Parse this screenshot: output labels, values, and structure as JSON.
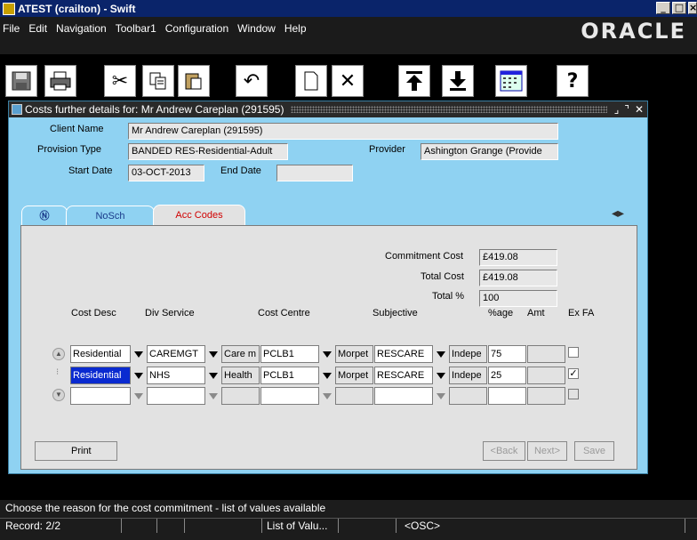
{
  "window": {
    "title": "ATEST (crailton) - Swift"
  },
  "menu": {
    "items": [
      "File",
      "Edit",
      "Navigation",
      "Toolbar1",
      "Configuration",
      "Window",
      "Help"
    ],
    "brand": "ORACLE"
  },
  "toolbar": {
    "icons": [
      "save-icon",
      "print-icon",
      "cut-icon",
      "copy-icon",
      "paste-icon",
      "undo-icon",
      "new-icon",
      "delete-icon",
      "first-record-icon",
      "last-record-icon",
      "calculator-icon",
      "help-icon"
    ],
    "help_label": "?"
  },
  "form": {
    "title": "Costs further details for: Mr Andrew Careplan (291595)",
    "client_name_label": "Client Name",
    "client_name": "Mr Andrew Careplan (291595)",
    "provision_type_label": "Provision Type",
    "provision_type": "BANDED RES-Residential-Adult",
    "provider_label": "Provider",
    "provider": "Ashington Grange (Provide",
    "start_date_label": "Start Date",
    "start_date": "03-OCT-2013",
    "end_date_label": "End Date",
    "end_date": ""
  },
  "tabs": [
    {
      "label": "NoSch"
    },
    {
      "label": "Acc Codes",
      "active": true
    }
  ],
  "summary": {
    "commitment_cost_label": "Commitment Cost",
    "commitment_cost": "£419.08",
    "total_cost_label": "Total Cost",
    "total_cost": "£419.08",
    "total_pct_label": "Total %",
    "total_pct": "100"
  },
  "grid": {
    "headers": {
      "cost_desc": "Cost Desc",
      "div_service": "Div Service",
      "cost_centre": "Cost Centre",
      "subjective": "Subjective",
      "pct": "%age",
      "amt": "Amt",
      "ex_fa": "Ex FA"
    },
    "rows": [
      {
        "cost_desc": "Residential",
        "div": "CAREMGT",
        "div_desc": "Care m",
        "centre": "PCLB1",
        "centre_desc": "Morpet",
        "subjective": "RESCARE",
        "subj_desc": "Indepe",
        "pct": "75",
        "amt": "",
        "ex_fa": false
      },
      {
        "cost_desc": "Residential",
        "div": "NHS",
        "div_desc": "Health",
        "centre": "PCLB1",
        "centre_desc": "Morpet",
        "subjective": "RESCARE",
        "subj_desc": "Indepe",
        "pct": "25",
        "amt": "",
        "ex_fa": true
      },
      {
        "cost_desc": "",
        "div": "",
        "div_desc": "",
        "centre": "",
        "centre_desc": "",
        "subjective": "",
        "subj_desc": "",
        "pct": "",
        "amt": "",
        "ex_fa": false
      }
    ]
  },
  "buttons": {
    "print": "Print",
    "back": "<Back",
    "next": "Next>",
    "save": "Save"
  },
  "status": {
    "message": "Choose the reason for the cost commitment - list of values available",
    "record": "Record: 2/2",
    "mode": "List of Valu...",
    "osc": "<OSC>"
  }
}
